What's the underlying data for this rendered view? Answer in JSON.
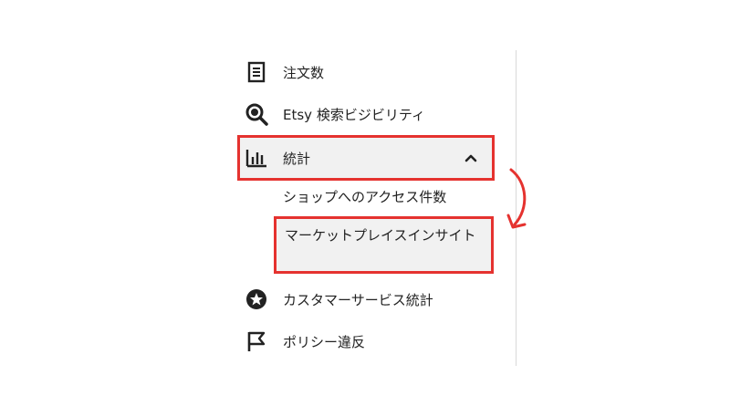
{
  "menu": {
    "items": [
      {
        "label": "注文数",
        "icon": "order-receipt-icon"
      },
      {
        "label": "Etsy 検索ビジビリティ",
        "icon": "search-magnifier-icon"
      },
      {
        "label": "統計",
        "icon": "bar-chart-icon",
        "expanded": true
      },
      {
        "label": "カスタマーサービス統計",
        "icon": "star-badge-icon"
      },
      {
        "label": "ポリシー違反",
        "icon": "flag-icon"
      }
    ],
    "stats_children": [
      {
        "label": "ショップへのアクセス件数"
      },
      {
        "label": "マーケットプレイスインサイト",
        "highlighted": true
      }
    ]
  },
  "colors": {
    "highlight_border": "#e5322f",
    "active_background": "#f1f1f1",
    "arrow": "#e5322f"
  }
}
